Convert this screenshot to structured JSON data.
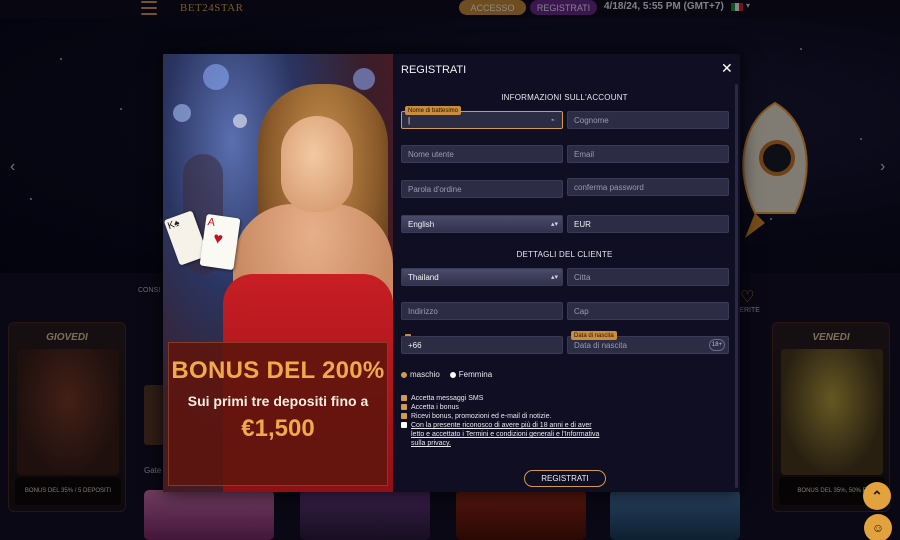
{
  "header": {
    "logo_text": "BET24STAR",
    "access_label": "ACCESSO",
    "register_label": "REGISTRATI",
    "datetime": "4/18/24, 5:55 PM (GMT+7)"
  },
  "site": {
    "cat_left": "CONSI",
    "cat_right": "FERITE",
    "card_left": {
      "day": "GIOVEDI",
      "promo": "BONUS DEL 35% / 5 DEPOSITI"
    },
    "card_right": {
      "day": "VENEDI",
      "promo": "BONUS DEL 35%, 50% E"
    },
    "game_label": "Gate"
  },
  "banner": {
    "title": "BONUS DEL 200%",
    "subtitle": "Sui primi tre depositi fino a",
    "amount": "€1,500"
  },
  "modal": {
    "title": "REGISTRATI",
    "account_section": "INFORMAZIONI SULL'ACCOUNT",
    "customer_section": "DETTAGLI DEL CLIENTE",
    "first_name_label": "Nome di battesimo",
    "first_name_value": "|",
    "last_name_placeholder": "Cognome",
    "username_placeholder": "Nome utente",
    "email_placeholder": "Email",
    "password_placeholder": "Parola d'ordine",
    "confirm_password_placeholder": "conferma password",
    "language_value": "English",
    "currency_value": "EUR",
    "country_value": "Thailand",
    "city_placeholder": "Citta",
    "address_placeholder": "Indirizzo",
    "zip_placeholder": "Cap",
    "phone_prefix": "+66",
    "dob_label": "Data di nascita",
    "dob_placeholder": "Data di nascita",
    "age_badge": "18+",
    "gender_male": "maschio",
    "gender_female": "Femmina",
    "check_sms": "Accetta messaggi SMS",
    "check_bonus": "Accetta i bonus",
    "check_news": "Ricevi bonus, promozioni ed e-mail di notizie.",
    "check_terms": "Con la presente riconosco di avere più di 18 anni e di aver letto e accettato i Termini e condizioni generali e l'Informativa sulla privacy.",
    "submit_label": "REGISTRATI"
  },
  "colors": {
    "accent": "#d39a4b",
    "register_purple": "#6a2a8e",
    "field_bg": "#2c2c44",
    "modal_bg": "#0f0e22"
  },
  "icons": [
    "hamburger-icon",
    "flag-italy-icon",
    "chevron-down-icon",
    "arrow-left-icon",
    "arrow-right-icon",
    "close-icon",
    "heart-icon",
    "chevron-up-icon",
    "support-icon",
    "dropdown-caret-icon"
  ]
}
